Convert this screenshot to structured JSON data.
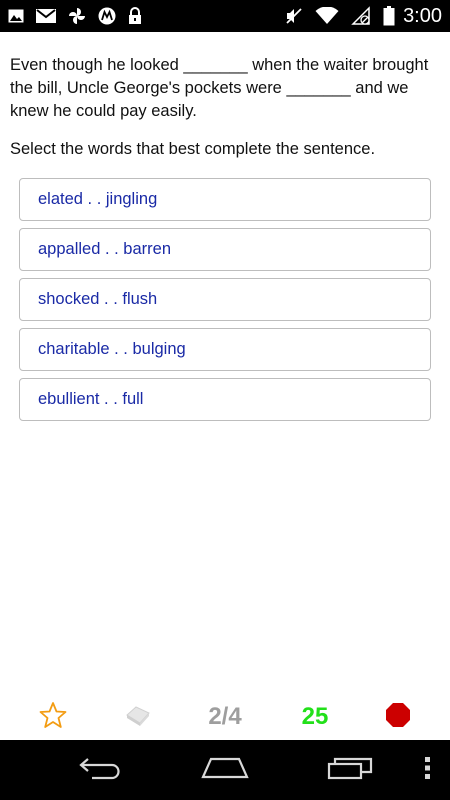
{
  "status_bar": {
    "time": "3:00",
    "left_icons": [
      "gallery-icon",
      "gmail-icon",
      "photos-icon",
      "motorola-icon",
      "lock-icon"
    ],
    "right_icons": [
      "mute-icon",
      "wifi-icon",
      "no-sim-icon",
      "battery-icon"
    ]
  },
  "question": {
    "text": "Even though he looked _______ when the waiter brought the bill, Uncle George's pockets were _______ and we knew he could pay easily.",
    "instruction": "Select the words that best complete the sentence."
  },
  "options": [
    "elated . . jingling",
    "appalled . . barren",
    "shocked . . flush",
    "charitable . . bulging",
    "ebullient . . full"
  ],
  "toolbar": {
    "progress": "2/4",
    "score": "25",
    "icons": [
      "star-icon",
      "hint-icon",
      "stop-icon"
    ]
  },
  "colors": {
    "option_text": "#1a2aa6",
    "score": "#22e01a",
    "progress": "#9e9e9e",
    "star": "#f39c12",
    "stop": "#cc0000"
  },
  "nav_bar": {
    "icons": [
      "back-icon",
      "home-icon",
      "recents-icon"
    ]
  }
}
